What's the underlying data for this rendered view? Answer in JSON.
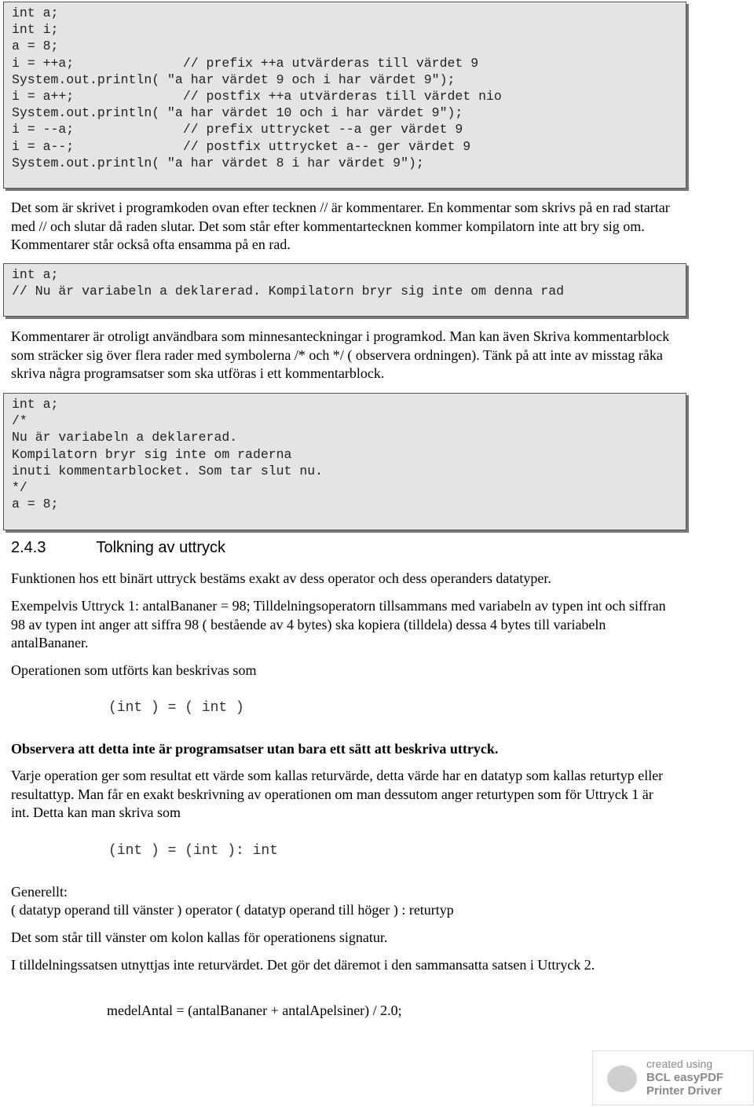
{
  "code1": [
    "int a;",
    "int i;",
    "a = 8;",
    "i = ++a;              // prefix ++a utvärderas till värdet 9",
    "System.out.println( \"a har värdet 9 och i har värdet 9\");",
    "i = a++;              // postfix ++a utvärderas till värdet nio",
    "System.out.println( \"a har värdet 10 och i har värdet 9\");",
    "i = --a;              // prefix uttrycket --a ger värdet 9",
    "i = a--;              // postfix uttrycket a-- ger värdet 9",
    "System.out.println( \"a har värdet 8 i har värdet 9\");"
  ],
  "p1": "Det som är skrivet i programkoden ovan efter tecknen // är kommentarer. En kommentar som skrivs på en rad startar med // och slutar då raden slutar. Det som står efter kommentartecknen kommer kompilatorn inte att bry sig om. Kommentarer står också ofta ensamma på en rad.",
  "code2": [
    "int a;",
    "// Nu är variabeln a deklarerad. Kompilatorn bryr sig inte om denna rad"
  ],
  "p2": "Kommentarer är otroligt användbara som minnesanteckningar i programkod. Man kan även Skriva kommentarblock som sträcker sig över flera rader med symbolerna /* och */ ( observera ordningen). Tänk på att inte av misstag råka skriva några programsatser som ska utföras i ett kommentarblock.",
  "code3": [
    "int a;",
    "/*",
    "Nu är variabeln a deklarerad.",
    "Kompilatorn bryr sig inte om raderna",
    "inuti kommentarblocket. Som tar slut nu.",
    "*/",
    "a = 8;"
  ],
  "section_number": "2.4.3",
  "section_title": "Tolkning av uttryck",
  "p3": "Funktionen hos ett binärt uttryck bestäms exakt av dess operator och dess operanders datatyper.",
  "p4": "Exempelvis Uttryck 1: antalBananer = 98; Tilldelningsoperatorn tillsammans med variabeln av typen int och siffran 98 av typen int anger att siffra 98 ( bestående av 4 bytes) ska kopiera (tilldela) dessa 4 bytes till variabeln antalBananer.",
  "p5": "Operationen som utförts kan beskrivas som",
  "m1": "(int ) = ( int )",
  "p6": "Observera att detta inte är programsatser utan bara ett sätt att beskriva uttryck.",
  "p7": "Varje operation ger som resultat ett värde som kallas returvärde, detta värde har en datatyp som kallas returtyp eller resultattyp. Man får en exakt beskrivning av operationen om man dessutom anger returtypen som för Uttryck 1 är int. Detta kan man skriva som",
  "m2": "(int ) = (int ): int",
  "p8a": "Generellt:",
  "p8b": "( datatyp operand till vänster ) operator ( datatyp operand till höger ) : returtyp",
  "p9": "Det som står till vänster om kolon kallas för operationens signatur.",
  "p10": "I tilldelningssatsen utnyttjas inte returvärdet. Det gör det däremot i den sammansatta satsen i Uttryck 2.",
  "p11": "medelAntal = (antalBananer + antalApelsiner) / 2.0;",
  "badge": {
    "line1": "created using",
    "line2": "BCL easyPDF",
    "line3": "Printer Driver",
    "icon": "printer-icon"
  }
}
